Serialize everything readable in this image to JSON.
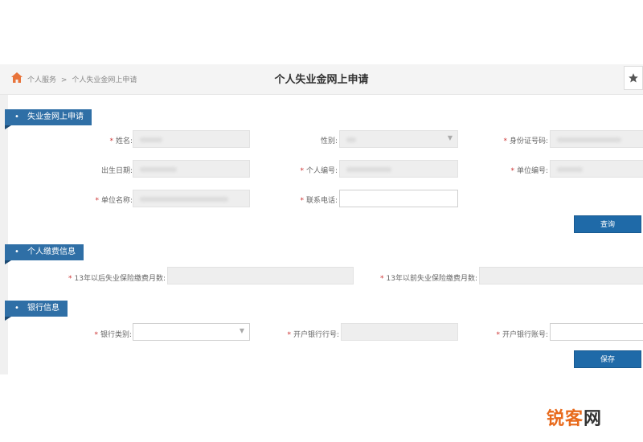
{
  "header": {
    "breadcrumb": [
      "个人服务",
      ">",
      "个人失业金网上申请"
    ],
    "title": "个人失业金网上申请"
  },
  "sections": {
    "s1": {
      "title": "失业金网上申请"
    },
    "s2": {
      "title": "个人缴费信息"
    },
    "s3": {
      "title": "银行信息"
    }
  },
  "form": {
    "name_label": "姓名:",
    "gender_label": "性别:",
    "idno_label": "身份证号码:",
    "birth_label": "出生日期:",
    "personal_no_label": "个人编号:",
    "unit_no_label": "单位编号:",
    "unit_name_label": "单位名称:",
    "phone_label": "联系电话:",
    "query_button": "查询",
    "after13_label": "13年以后失业保险缴费月数:",
    "before13_label": "13年以前失业保险缴费月数:",
    "bank_type_label": "银行类别:",
    "bank_branch_label": "开户银行行号:",
    "bank_account_label": "开户银行账号:",
    "save_button": "保存"
  },
  "watermark": {
    "text_a": "锐客",
    "text_b": "网"
  },
  "colors": {
    "accent": "#1f6aa8",
    "required": "#cc3333",
    "tab": "#2f6fa6",
    "watermark": "#e86a1c"
  }
}
